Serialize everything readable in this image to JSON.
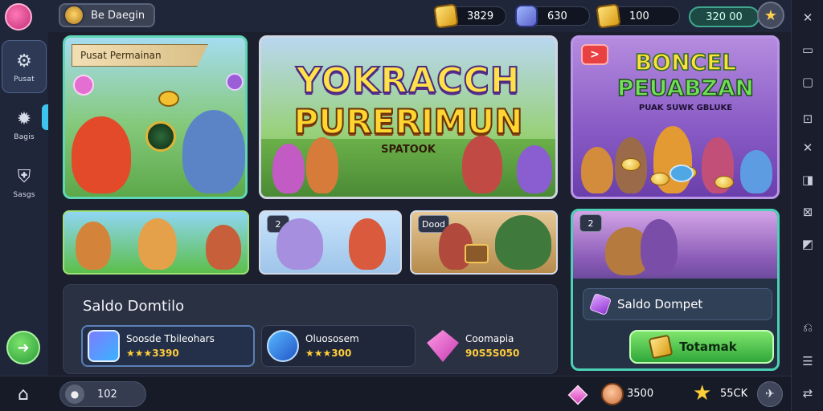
{
  "topbar": {
    "username": "Be Daegin",
    "resources": [
      {
        "icon": "gold-chest-icon",
        "value": "3829"
      },
      {
        "icon": "gem-chest-icon",
        "value": "630"
      },
      {
        "icon": "gold-bar-icon",
        "value": "100"
      }
    ],
    "cash": "320 00"
  },
  "sidebar": {
    "items": [
      {
        "icon": "gear-icon",
        "label": "Pusat"
      },
      {
        "icon": "settings-icon",
        "label": "Bagis"
      },
      {
        "icon": "bell-icon",
        "label": "Sasgs"
      }
    ]
  },
  "cards": {
    "promo_label": "Pusat Permainan",
    "hero_title_1": "YOKRACCH",
    "hero_title_2": "PURERIMUN",
    "hero_sub": "SPATOOK",
    "bonus_badge": ">",
    "bonus_title_1": "BONCEL",
    "bonus_title_2": "PEUABZAN",
    "bonus_sub": "PUAK SUWK GBLUKE",
    "mini_badges": [
      "",
      "2",
      "Dood"
    ],
    "event_badge": "2"
  },
  "saldo": {
    "title": "Saldo Domtilo",
    "wallets": [
      {
        "name": "Soosde Tbileohars",
        "value": "★★★3390"
      },
      {
        "name": "Oluososem",
        "value": "★★★300"
      },
      {
        "name": "Coomapia",
        "value": "90S5S050"
      }
    ]
  },
  "event": {
    "saldo_label": "Saldo Dompet",
    "topup_label": "Totamak"
  },
  "bottombar": {
    "chat_count": "102",
    "coins": "3500",
    "stars": "55CK"
  }
}
